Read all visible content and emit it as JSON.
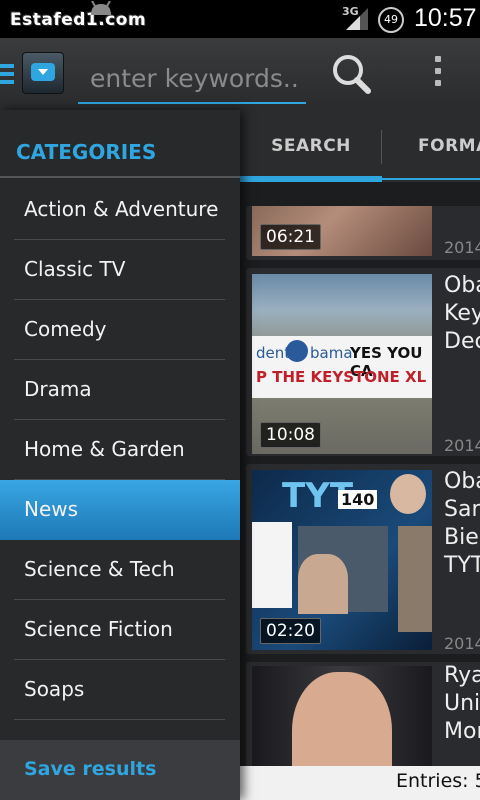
{
  "status_bar": {
    "watermark": "Estafed1.com",
    "network": "3G",
    "battery": "49",
    "time": "10:57"
  },
  "app_bar": {
    "search_placeholder": "enter keywords..."
  },
  "tabs": [
    "SEARCH",
    "FORMA"
  ],
  "videos": [
    {
      "duration": "06:21",
      "title": "",
      "year": "2014"
    },
    {
      "duration": "10:08",
      "title": "Oba\nKey\nDec",
      "year": "2014"
    },
    {
      "duration": "02:20",
      "title": "Oba\nSan\nBiel\nTYT",
      "year": "2014"
    },
    {
      "duration": "",
      "title": "Rya\nUnit\nMor",
      "year": ""
    }
  ],
  "thumbnail_text": {
    "banner": "YES YOU CA",
    "banner_left": "dent",
    "banner_name": "bama",
    "banner_bottom": "P THE KEYSTONE XL",
    "tyt_logo": "TYT",
    "tyt_number": "140"
  },
  "entries": "Entries: 5",
  "drawer": {
    "header": "CATEGORIES",
    "categories": [
      "Action & Adventure",
      "Classic TV",
      "Comedy",
      "Drama",
      "Home & Garden",
      "News",
      "Science & Tech",
      "Science Fiction",
      "Soaps"
    ],
    "active_category": "News",
    "save_label": "Save results"
  },
  "colors": {
    "accent": "#2fa6e0",
    "active_item": "#2a8ed0"
  }
}
